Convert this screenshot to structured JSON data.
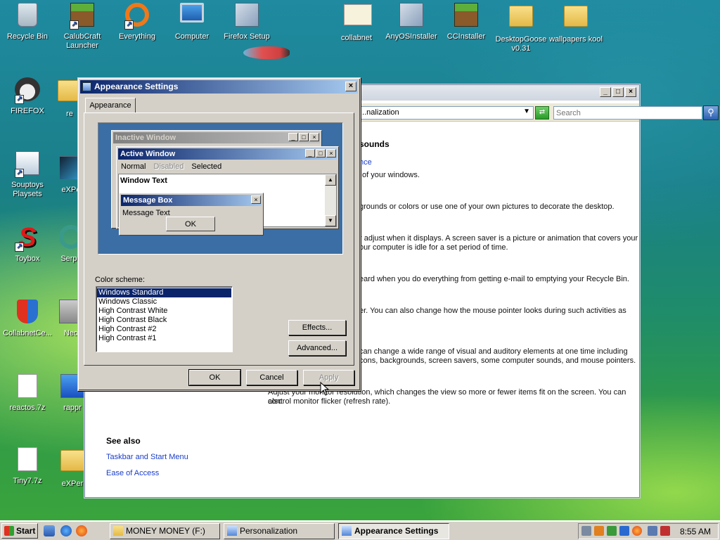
{
  "desktop_icons": [
    {
      "label": "Recycle Bin",
      "icon": "recycle-bin-icon"
    },
    {
      "label": "CalubCraft Launcher",
      "icon": "grass-block-icon"
    },
    {
      "label": "Everything",
      "icon": "everything-icon"
    },
    {
      "label": "Computer",
      "icon": "computer-icon"
    },
    {
      "label": "Firefox Setup",
      "icon": "installer-icon"
    },
    {
      "label": "collabnet",
      "icon": "certificate-icon"
    },
    {
      "label": "AnyOSInstaller",
      "icon": "installer-icon"
    },
    {
      "label": "CCInstaller",
      "icon": "grass-block-icon"
    },
    {
      "label": "DesktopGoose v0.31",
      "icon": "folder-icon"
    },
    {
      "label": "wallpapers kool",
      "icon": "folder-icon"
    },
    {
      "label": "FIREFOX",
      "icon": "raccoon-icon"
    },
    {
      "label": "re",
      "icon": "folder-icon"
    },
    {
      "label": "Souptoys Playsets",
      "icon": "app-icon"
    },
    {
      "label": "eXPe",
      "icon": "app-icon"
    },
    {
      "label": "Toybox",
      "icon": "toybox-icon"
    },
    {
      "label": "Serpe",
      "icon": "app-icon"
    },
    {
      "label": "CollabnetCe...",
      "icon": "installer-shield-icon"
    },
    {
      "label": "Neo",
      "icon": "app-icon"
    },
    {
      "label": "reactos.7z",
      "icon": "document-icon"
    },
    {
      "label": "rappr",
      "icon": "app-icon"
    },
    {
      "label": "Tiny7.7z",
      "icon": "document-icon"
    },
    {
      "label": "eXPer",
      "icon": "folder-icon"
    }
  ],
  "personalization": {
    "address": "...nalization",
    "search_placeholder": "Search",
    "heading": "sounds",
    "link_appearance": "nce",
    "line_windows": "of your windows.",
    "line_desktop": "grounds or colors or use one of your own pictures to decorate the desktop.",
    "line_saver_1": "r adjust when it displays. A screen saver is a picture or animation that covers your",
    "line_saver_2": "our computer is idle for a set period of time.",
    "line_sounds": "eard when you do everything from getting e-mail to emptying your Recycle Bin.",
    "line_mouse": "er. You can also change how the mouse pointer looks during such activities as",
    "line_theme_1": "can change a wide range of visual and auditory elements at one time including",
    "line_theme_2": "cons, backgrounds, screen savers, some computer sounds, and mouse pointers.",
    "line_display_1": "Adjust your monitor resolution, which changes the view so more or fewer items fit on the screen. You can also",
    "line_display_2": "control monitor flicker (refresh rate).",
    "see_also": "See also",
    "link_taskbar": "Taskbar and Start Menu",
    "link_ease": "Ease of Access"
  },
  "dialog": {
    "title": "Appearance Settings",
    "tab": "Appearance",
    "preview": {
      "inactive_title": "Inactive Window",
      "active_title": "Active Window",
      "menu_normal": "Normal",
      "menu_disabled": "Disabled",
      "menu_selected": "Selected",
      "window_text": "Window Text",
      "msgbox_title": "Message Box",
      "msgbox_text": "Message Text",
      "msgbox_ok": "OK"
    },
    "scheme_label": "Color scheme:",
    "schemes": [
      "Windows Standard",
      "Windows Classic",
      "High Contrast White",
      "High Contrast Black",
      "High Contrast #2",
      "High Contrast #1"
    ],
    "selected_scheme": "Windows Standard",
    "effects_label": "Effects...",
    "advanced_label": "Advanced...",
    "ok_label": "OK",
    "cancel_label": "Cancel",
    "apply_label": "Apply",
    "colors": {
      "active_title": "#0a246a",
      "inactive_title": "#808080",
      "preview_desktop": "#3a6ea5"
    }
  },
  "taskbar": {
    "start_label": "Start",
    "tasks": [
      {
        "label": "MONEY MONEY (F:)",
        "active": false
      },
      {
        "label": "Personalization",
        "active": false
      },
      {
        "label": "Appearance Settings",
        "active": true
      }
    ],
    "clock": "8:55 AM"
  }
}
